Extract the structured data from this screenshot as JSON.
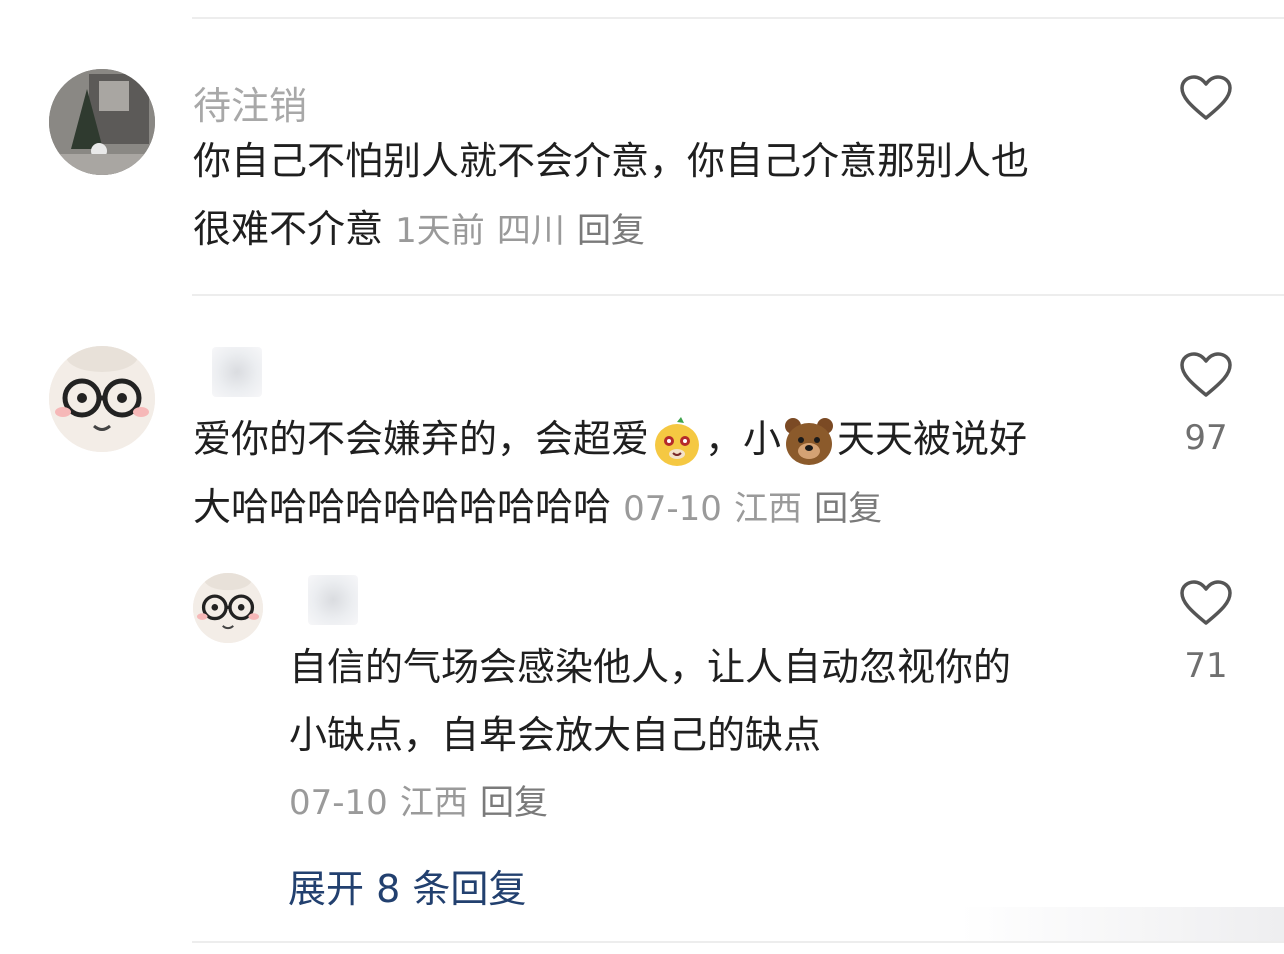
{
  "comments": [
    {
      "username": "待注销",
      "line1": "你自己不怕别人就不会介意，你自己介意那别人也",
      "line2": "很难不介意",
      "time": "1天前",
      "location": "四川",
      "reply_label": "回复",
      "likes": ""
    },
    {
      "line1_a": "爱你的不会嫌弃的，会超爱",
      "line1_b": "，小",
      "line1_c": "天天被说好",
      "line2": "大哈哈哈哈哈哈哈哈哈哈",
      "time": "07-10",
      "location": "江西",
      "reply_label": "回复",
      "likes": "97",
      "reply": {
        "line1": "自信的气场会感染他人，让人自动忽视你的",
        "line2": "小缺点，自卑会放大自己的缺点",
        "time": "07-10",
        "location": "江西",
        "reply_label": "回复",
        "likes": "71"
      },
      "expand_label": "展开 8 条回复"
    }
  ],
  "icons": {
    "heart": "heart-outline-icon",
    "emoji_1": "smiling-yellow-creature-emoji",
    "emoji_2": "bear-face-emoji"
  },
  "colors": {
    "link": "#22406f",
    "meta": "#9a9a9a",
    "text": "#1f1f1f"
  }
}
